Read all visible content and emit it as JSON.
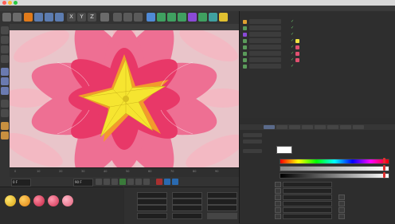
{
  "window": {
    "title": ""
  },
  "menu": {
    "items": [
      "",
      "",
      "",
      "",
      "",
      "",
      "",
      "",
      "",
      "",
      "",
      "",
      "",
      ""
    ]
  },
  "toolbar": {
    "axis_labels": [
      "X",
      "Y",
      "Z"
    ]
  },
  "watermark": {
    "text": ""
  },
  "timeline": {
    "ticks": [
      "0",
      "10",
      "20",
      "30",
      "40",
      "50",
      "60",
      "70",
      "80",
      "90"
    ]
  },
  "transport": {
    "start_value": "0 F",
    "end_value": "90 F"
  },
  "colors": {
    "accent": "#f4e030",
    "petal": "#e8507a",
    "viewport_bg": "#e7c8cc"
  }
}
